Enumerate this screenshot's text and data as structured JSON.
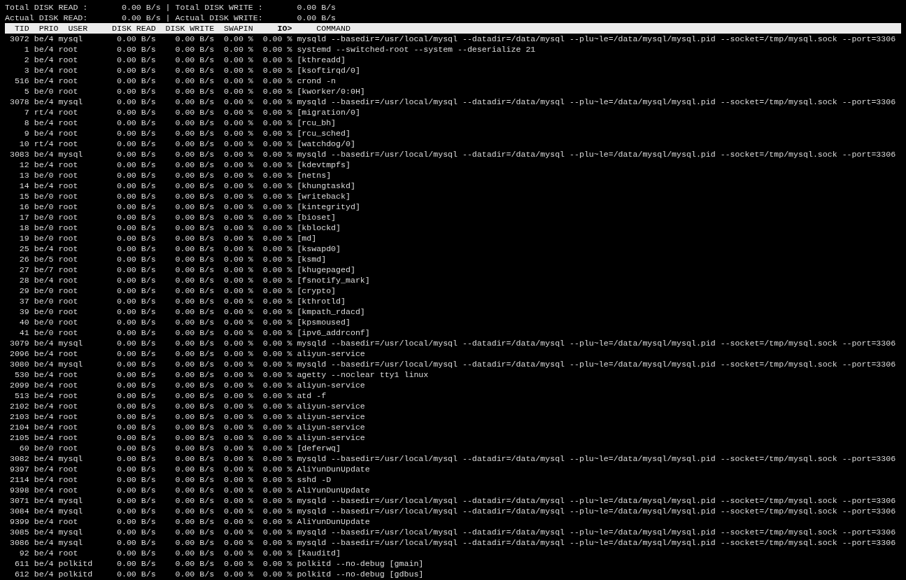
{
  "summary": [
    {
      "read_label": "Total DISK READ :",
      "read_value": "0.00 B/s",
      "separator": "|",
      "write_label": "Total DISK WRITE :",
      "write_value": "0.00 B/s"
    },
    {
      "read_label": "Actual DISK READ:",
      "read_value": "0.00 B/s",
      "separator": "|",
      "write_label": "Actual DISK WRITE:",
      "write_value": "0.00 B/s"
    }
  ],
  "table": {
    "columns": [
      {
        "label": "TID",
        "sorted": false
      },
      {
        "label": "PRIO",
        "sorted": false
      },
      {
        "label": "USER",
        "sorted": false
      },
      {
        "label": "DISK READ",
        "sorted": false
      },
      {
        "label": "DISK WRITE",
        "sorted": false
      },
      {
        "label": "SWAPIN",
        "sorted": false
      },
      {
        "label": "IO>",
        "sorted": true
      },
      {
        "label": "COMMAND",
        "sorted": false
      }
    ],
    "rows": [
      [
        "3072",
        "be/4",
        "mysql",
        "0.00 B/s",
        "0.00 B/s",
        "0.00 %",
        "0.00 %",
        "mysqld --basedir=/usr/local/mysql --datadir=/data/mysql --plu~le=/data/mysql/mysql.pid --socket=/tmp/mysql.sock --port=3306"
      ],
      [
        "1",
        "be/4",
        "root",
        "0.00 B/s",
        "0.00 B/s",
        "0.00 %",
        "0.00 %",
        "systemd --switched-root --system --deserialize 21"
      ],
      [
        "2",
        "be/4",
        "root",
        "0.00 B/s",
        "0.00 B/s",
        "0.00 %",
        "0.00 %",
        "[kthreadd]"
      ],
      [
        "3",
        "be/4",
        "root",
        "0.00 B/s",
        "0.00 B/s",
        "0.00 %",
        "0.00 %",
        "[ksoftirqd/0]"
      ],
      [
        "516",
        "be/4",
        "root",
        "0.00 B/s",
        "0.00 B/s",
        "0.00 %",
        "0.00 %",
        "crond -n"
      ],
      [
        "5",
        "be/0",
        "root",
        "0.00 B/s",
        "0.00 B/s",
        "0.00 %",
        "0.00 %",
        "[kworker/0:0H]"
      ],
      [
        "3078",
        "be/4",
        "mysql",
        "0.00 B/s",
        "0.00 B/s",
        "0.00 %",
        "0.00 %",
        "mysqld --basedir=/usr/local/mysql --datadir=/data/mysql --plu~le=/data/mysql/mysql.pid --socket=/tmp/mysql.sock --port=3306"
      ],
      [
        "7",
        "rt/4",
        "root",
        "0.00 B/s",
        "0.00 B/s",
        "0.00 %",
        "0.00 %",
        "[migration/0]"
      ],
      [
        "8",
        "be/4",
        "root",
        "0.00 B/s",
        "0.00 B/s",
        "0.00 %",
        "0.00 %",
        "[rcu_bh]"
      ],
      [
        "9",
        "be/4",
        "root",
        "0.00 B/s",
        "0.00 B/s",
        "0.00 %",
        "0.00 %",
        "[rcu_sched]"
      ],
      [
        "10",
        "rt/4",
        "root",
        "0.00 B/s",
        "0.00 B/s",
        "0.00 %",
        "0.00 %",
        "[watchdog/0]"
      ],
      [
        "3083",
        "be/4",
        "mysql",
        "0.00 B/s",
        "0.00 B/s",
        "0.00 %",
        "0.00 %",
        "mysqld --basedir=/usr/local/mysql --datadir=/data/mysql --plu~le=/data/mysql/mysql.pid --socket=/tmp/mysql.sock --port=3306"
      ],
      [
        "12",
        "be/4",
        "root",
        "0.00 B/s",
        "0.00 B/s",
        "0.00 %",
        "0.00 %",
        "[kdevtmpfs]"
      ],
      [
        "13",
        "be/0",
        "root",
        "0.00 B/s",
        "0.00 B/s",
        "0.00 %",
        "0.00 %",
        "[netns]"
      ],
      [
        "14",
        "be/4",
        "root",
        "0.00 B/s",
        "0.00 B/s",
        "0.00 %",
        "0.00 %",
        "[khungtaskd]"
      ],
      [
        "15",
        "be/0",
        "root",
        "0.00 B/s",
        "0.00 B/s",
        "0.00 %",
        "0.00 %",
        "[writeback]"
      ],
      [
        "16",
        "be/0",
        "root",
        "0.00 B/s",
        "0.00 B/s",
        "0.00 %",
        "0.00 %",
        "[kintegrityd]"
      ],
      [
        "17",
        "be/0",
        "root",
        "0.00 B/s",
        "0.00 B/s",
        "0.00 %",
        "0.00 %",
        "[bioset]"
      ],
      [
        "18",
        "be/0",
        "root",
        "0.00 B/s",
        "0.00 B/s",
        "0.00 %",
        "0.00 %",
        "[kblockd]"
      ],
      [
        "19",
        "be/0",
        "root",
        "0.00 B/s",
        "0.00 B/s",
        "0.00 %",
        "0.00 %",
        "[md]"
      ],
      [
        "25",
        "be/4",
        "root",
        "0.00 B/s",
        "0.00 B/s",
        "0.00 %",
        "0.00 %",
        "[kswapd0]"
      ],
      [
        "26",
        "be/5",
        "root",
        "0.00 B/s",
        "0.00 B/s",
        "0.00 %",
        "0.00 %",
        "[ksmd]"
      ],
      [
        "27",
        "be/7",
        "root",
        "0.00 B/s",
        "0.00 B/s",
        "0.00 %",
        "0.00 %",
        "[khugepaged]"
      ],
      [
        "28",
        "be/4",
        "root",
        "0.00 B/s",
        "0.00 B/s",
        "0.00 %",
        "0.00 %",
        "[fsnotify_mark]"
      ],
      [
        "29",
        "be/0",
        "root",
        "0.00 B/s",
        "0.00 B/s",
        "0.00 %",
        "0.00 %",
        "[crypto]"
      ],
      [
        "37",
        "be/0",
        "root",
        "0.00 B/s",
        "0.00 B/s",
        "0.00 %",
        "0.00 %",
        "[kthrotld]"
      ],
      [
        "39",
        "be/0",
        "root",
        "0.00 B/s",
        "0.00 B/s",
        "0.00 %",
        "0.00 %",
        "[kmpath_rdacd]"
      ],
      [
        "40",
        "be/0",
        "root",
        "0.00 B/s",
        "0.00 B/s",
        "0.00 %",
        "0.00 %",
        "[kpsmoused]"
      ],
      [
        "41",
        "be/0",
        "root",
        "0.00 B/s",
        "0.00 B/s",
        "0.00 %",
        "0.00 %",
        "[ipv6_addrconf]"
      ],
      [
        "3079",
        "be/4",
        "mysql",
        "0.00 B/s",
        "0.00 B/s",
        "0.00 %",
        "0.00 %",
        "mysqld --basedir=/usr/local/mysql --datadir=/data/mysql --plu~le=/data/mysql/mysql.pid --socket=/tmp/mysql.sock --port=3306"
      ],
      [
        "2096",
        "be/4",
        "root",
        "0.00 B/s",
        "0.00 B/s",
        "0.00 %",
        "0.00 %",
        "aliyun-service"
      ],
      [
        "3080",
        "be/4",
        "mysql",
        "0.00 B/s",
        "0.00 B/s",
        "0.00 %",
        "0.00 %",
        "mysqld --basedir=/usr/local/mysql --datadir=/data/mysql --plu~le=/data/mysql/mysql.pid --socket=/tmp/mysql.sock --port=3306"
      ],
      [
        "530",
        "be/4",
        "root",
        "0.00 B/s",
        "0.00 B/s",
        "0.00 %",
        "0.00 %",
        "agetty --noclear tty1 linux"
      ],
      [
        "2099",
        "be/4",
        "root",
        "0.00 B/s",
        "0.00 B/s",
        "0.00 %",
        "0.00 %",
        "aliyun-service"
      ],
      [
        "513",
        "be/4",
        "root",
        "0.00 B/s",
        "0.00 B/s",
        "0.00 %",
        "0.00 %",
        "atd -f"
      ],
      [
        "2102",
        "be/4",
        "root",
        "0.00 B/s",
        "0.00 B/s",
        "0.00 %",
        "0.00 %",
        "aliyun-service"
      ],
      [
        "2103",
        "be/4",
        "root",
        "0.00 B/s",
        "0.00 B/s",
        "0.00 %",
        "0.00 %",
        "aliyun-service"
      ],
      [
        "2104",
        "be/4",
        "root",
        "0.00 B/s",
        "0.00 B/s",
        "0.00 %",
        "0.00 %",
        "aliyun-service"
      ],
      [
        "2105",
        "be/4",
        "root",
        "0.00 B/s",
        "0.00 B/s",
        "0.00 %",
        "0.00 %",
        "aliyun-service"
      ],
      [
        "60",
        "be/0",
        "root",
        "0.00 B/s",
        "0.00 B/s",
        "0.00 %",
        "0.00 %",
        "[deferwq]"
      ],
      [
        "3082",
        "be/4",
        "mysql",
        "0.00 B/s",
        "0.00 B/s",
        "0.00 %",
        "0.00 %",
        "mysqld --basedir=/usr/local/mysql --datadir=/data/mysql --plu~le=/data/mysql/mysql.pid --socket=/tmp/mysql.sock --port=3306"
      ],
      [
        "9397",
        "be/4",
        "root",
        "0.00 B/s",
        "0.00 B/s",
        "0.00 %",
        "0.00 %",
        "AliYunDunUpdate"
      ],
      [
        "2114",
        "be/4",
        "root",
        "0.00 B/s",
        "0.00 B/s",
        "0.00 %",
        "0.00 %",
        "sshd -D"
      ],
      [
        "9398",
        "be/4",
        "root",
        "0.00 B/s",
        "0.00 B/s",
        "0.00 %",
        "0.00 %",
        "AliYunDunUpdate"
      ],
      [
        "3071",
        "be/4",
        "mysql",
        "0.00 B/s",
        "0.00 B/s",
        "0.00 %",
        "0.00 %",
        "mysqld --basedir=/usr/local/mysql --datadir=/data/mysql --plu~le=/data/mysql/mysql.pid --socket=/tmp/mysql.sock --port=3306"
      ],
      [
        "3084",
        "be/4",
        "mysql",
        "0.00 B/s",
        "0.00 B/s",
        "0.00 %",
        "0.00 %",
        "mysqld --basedir=/usr/local/mysql --datadir=/data/mysql --plu~le=/data/mysql/mysql.pid --socket=/tmp/mysql.sock --port=3306"
      ],
      [
        "9399",
        "be/4",
        "root",
        "0.00 B/s",
        "0.00 B/s",
        "0.00 %",
        "0.00 %",
        "AliYunDunUpdate"
      ],
      [
        "3085",
        "be/4",
        "mysql",
        "0.00 B/s",
        "0.00 B/s",
        "0.00 %",
        "0.00 %",
        "mysqld --basedir=/usr/local/mysql --datadir=/data/mysql --plu~le=/data/mysql/mysql.pid --socket=/tmp/mysql.sock --port=3306"
      ],
      [
        "3086",
        "be/4",
        "mysql",
        "0.00 B/s",
        "0.00 B/s",
        "0.00 %",
        "0.00 %",
        "mysqld --basedir=/usr/local/mysql --datadir=/data/mysql --plu~le=/data/mysql/mysql.pid --socket=/tmp/mysql.sock --port=3306"
      ],
      [
        "92",
        "be/4",
        "root",
        "0.00 B/s",
        "0.00 B/s",
        "0.00 %",
        "0.00 %",
        "[kauditd]"
      ],
      [
        "611",
        "be/4",
        "polkitd",
        "0.00 B/s",
        "0.00 B/s",
        "0.00 %",
        "0.00 %",
        "polkitd --no-debug [gmain]"
      ],
      [
        "612",
        "be/4",
        "polkitd",
        "0.00 B/s",
        "0.00 B/s",
        "0.00 %",
        "0.00 %",
        "polkitd --no-debug [gdbus]"
      ]
    ]
  }
}
